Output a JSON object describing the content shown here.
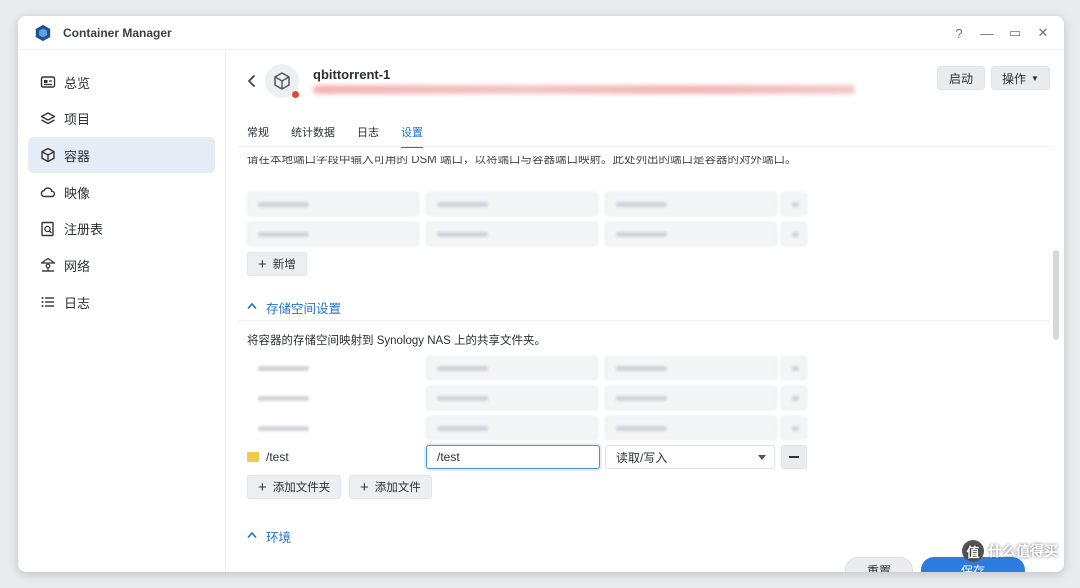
{
  "window": {
    "title": "Container Manager",
    "controls": [
      "?",
      "—",
      "▭",
      "✕"
    ]
  },
  "sidebar": {
    "items": [
      {
        "label": "总览",
        "icon": "overview-icon"
      },
      {
        "label": "项目",
        "icon": "layers-icon"
      },
      {
        "label": "容器",
        "icon": "cube-icon",
        "active": true
      },
      {
        "label": "映像",
        "icon": "cloud-icon"
      },
      {
        "label": "注册表",
        "icon": "registry-search-icon"
      },
      {
        "label": "网络",
        "icon": "network-icon"
      },
      {
        "label": "日志",
        "icon": "list-icon"
      }
    ]
  },
  "header": {
    "container_name": "qbittorrent-1",
    "status_color": "#e0463b",
    "start_button": "启动",
    "action_button": "操作"
  },
  "tabs": [
    {
      "label": "常规"
    },
    {
      "label": "统计数据"
    },
    {
      "label": "日志"
    },
    {
      "label": "设置",
      "active": true
    }
  ],
  "ports": {
    "description": "请在本地端口字段中输入可用的 DSM 端口，以将端口与容器端口映射。此处列出的端口是容器的对外端口。",
    "add_button": "新增"
  },
  "storage": {
    "section_title": "存储空间设置",
    "description": "将容器的存储空间映射到 Synology NAS 上的共享文件夹。",
    "new_row": {
      "folder": "/test",
      "mount_path": "/test",
      "mode": "读取/写入"
    },
    "add_folder_button": "添加文件夹",
    "add_file_button": "添加文件"
  },
  "environment": {
    "section_title": "环境"
  },
  "footer": {
    "reset_button": "重置",
    "save_button": "保存"
  },
  "watermark": {
    "badge": "值",
    "text": "什么值得买"
  },
  "colors": {
    "accent": "#1f74d0",
    "primary_button": "#2d7de0"
  }
}
